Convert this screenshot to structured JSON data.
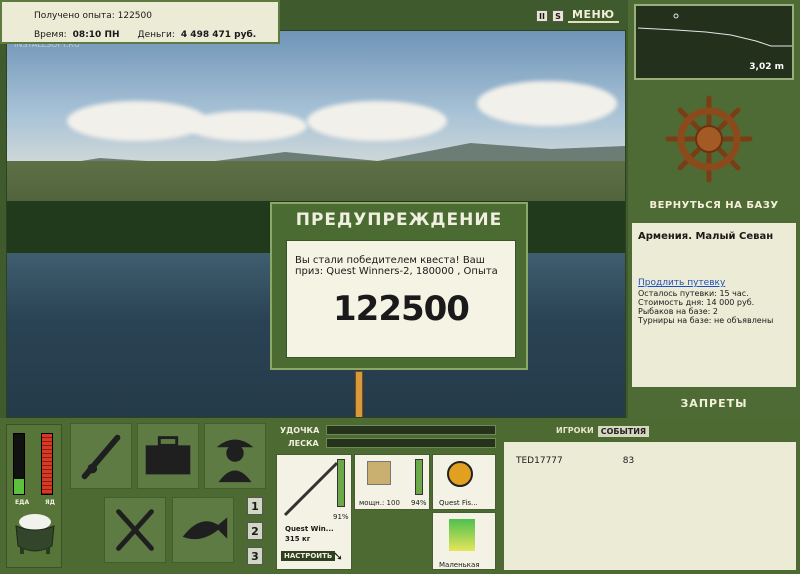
{
  "info": {
    "xp_label": "Получено опыта:",
    "xp_value": "122500",
    "time_label": "Время:",
    "time_value": "08:10 ПН",
    "money_label": "Деньги:",
    "money_value": "4 498 471 руб."
  },
  "watermark": "INSTALLSOFT.RU",
  "top_buttons": {
    "pause": "II",
    "sound": "S",
    "menu": "МЕНЮ"
  },
  "depth": {
    "value": "3,02 m"
  },
  "base": {
    "back_label": "ВЕРНУТЬСЯ НА БАЗУ",
    "location": "Армения. Малый Севан",
    "extend_link": "Продлить путевку",
    "lines": [
      "Осталось путевки: 15 час.",
      "Стоимость дня: 14 000 руб.",
      "Рыбаков на базе: 2",
      "Турниры на базе: не объявлены"
    ],
    "bans_label": "ЗАПРЕТЫ"
  },
  "dialog": {
    "title": "ПРЕДУПРЕЖДЕНИЕ",
    "message": "Вы стали победителем квеста! Ваш приз: Quest Winners-2, 180000 , Опыта",
    "score": "122500"
  },
  "meters": {
    "food_label": "ЕДА",
    "poison_label": "ЯД",
    "food_level": 0.25,
    "poison_level": 1.0
  },
  "tool_numbers": [
    "1",
    "2",
    "3"
  ],
  "gear": {
    "rod_label": "УДОЧКА",
    "line_label": "ЛЕСКА",
    "rod_percent": "91%",
    "rod_name": "Quest Win...",
    "rod_weight": "315 кг",
    "setup_button": "НАСТРОИТЬ",
    "reel_power": "мощн.: 100",
    "reel_percent": "94%",
    "line_name": "Quest Fis...",
    "lure_name": "Маленькая"
  },
  "players": {
    "tab_players": "ИГРОКИ",
    "tab_events": "СОБЫТИЯ",
    "rows": [
      {
        "name": "TED17777",
        "value": "83"
      }
    ]
  }
}
